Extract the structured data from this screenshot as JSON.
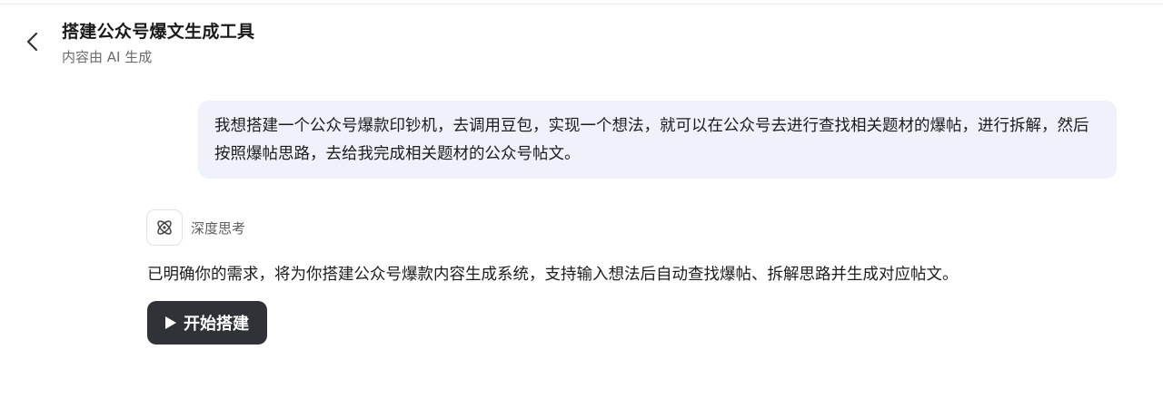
{
  "header": {
    "title": "搭建公众号爆文生成工具",
    "subtitle": "内容由 AI 生成",
    "back_icon": "chevron-left-icon"
  },
  "user_message": {
    "text": "我想搭建一个公众号爆款印钞机，去调用豆包，实现一个想法，就可以在公众号去进行查找相关题材的爆帖，进行拆解，然后按照爆帖思路，去给我完成相关题材的公众号帖文。"
  },
  "assistant": {
    "thinking_label": "深度思考",
    "thinking_icon": "atom-icon",
    "reply": "已明确你的需求，将为你搭建公众号爆款内容生成系统，支持输入想法后自动查找爆帖、拆解思路并生成对应帖文。",
    "action_button": {
      "label": "开始搭建",
      "icon": "play-icon"
    }
  },
  "colors": {
    "user_bubble_bg": "#eff1fb",
    "button_bg": "#303237"
  }
}
